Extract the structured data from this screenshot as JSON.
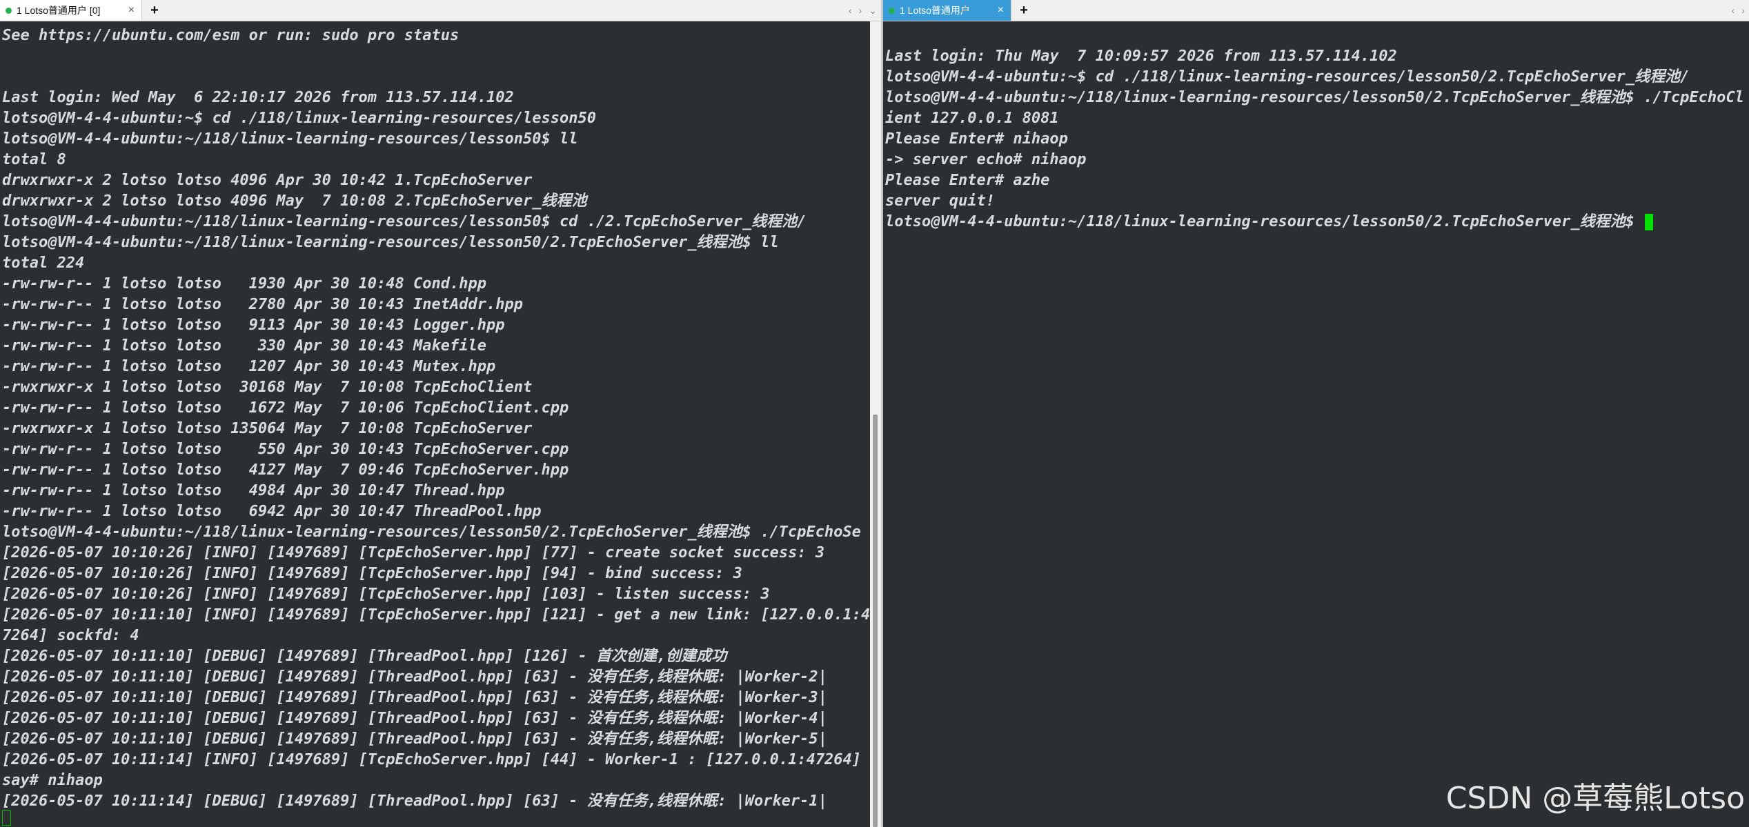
{
  "left": {
    "tab_title": "1 Lotso普通用户 [0]",
    "lines": [
      "See https://ubuntu.com/esm or run: sudo pro status",
      "",
      "",
      "Last login: Wed May  6 22:10:17 2026 from 113.57.114.102",
      "lotso@VM-4-4-ubuntu:~$ cd ./118/linux-learning-resources/lesson50",
      "lotso@VM-4-4-ubuntu:~/118/linux-learning-resources/lesson50$ ll",
      "total 8",
      "drwxrwxr-x 2 lotso lotso 4096 Apr 30 10:42 1.TcpEchoServer",
      "drwxrwxr-x 2 lotso lotso 4096 May  7 10:08 2.TcpEchoServer_线程池",
      "lotso@VM-4-4-ubuntu:~/118/linux-learning-resources/lesson50$ cd ./2.TcpEchoServer_线程池/",
      "lotso@VM-4-4-ubuntu:~/118/linux-learning-resources/lesson50/2.TcpEchoServer_线程池$ ll",
      "total 224",
      "-rw-rw-r-- 1 lotso lotso   1930 Apr 30 10:48 Cond.hpp",
      "-rw-rw-r-- 1 lotso lotso   2780 Apr 30 10:43 InetAddr.hpp",
      "-rw-rw-r-- 1 lotso lotso   9113 Apr 30 10:43 Logger.hpp",
      "-rw-rw-r-- 1 lotso lotso    330 Apr 30 10:43 Makefile",
      "-rw-rw-r-- 1 lotso lotso   1207 Apr 30 10:43 Mutex.hpp",
      "-rwxrwxr-x 1 lotso lotso  30168 May  7 10:08 TcpEchoClient",
      "-rw-rw-r-- 1 lotso lotso   1672 May  7 10:06 TcpEchoClient.cpp",
      "-rwxrwxr-x 1 lotso lotso 135064 May  7 10:08 TcpEchoServer",
      "-rw-rw-r-- 1 lotso lotso    550 Apr 30 10:43 TcpEchoServer.cpp",
      "-rw-rw-r-- 1 lotso lotso   4127 May  7 09:46 TcpEchoServer.hpp",
      "-rw-rw-r-- 1 lotso lotso   4984 Apr 30 10:47 Thread.hpp",
      "-rw-rw-r-- 1 lotso lotso   6942 Apr 30 10:47 ThreadPool.hpp",
      "lotso@VM-4-4-ubuntu:~/118/linux-learning-resources/lesson50/2.TcpEchoServer_线程池$ ./TcpEchoSe",
      "[2026-05-07 10:10:26] [INFO] [1497689] [TcpEchoServer.hpp] [77] - create socket success: 3",
      "[2026-05-07 10:10:26] [INFO] [1497689] [TcpEchoServer.hpp] [94] - bind success: 3",
      "[2026-05-07 10:10:26] [INFO] [1497689] [TcpEchoServer.hpp] [103] - listen success: 3",
      "[2026-05-07 10:11:10] [INFO] [1497689] [TcpEchoServer.hpp] [121] - get a new link: [127.0.0.1:4",
      "7264] sockfd: 4",
      "[2026-05-07 10:11:10] [DEBUG] [1497689] [ThreadPool.hpp] [126] - 首次创建,创建成功",
      "[2026-05-07 10:11:10] [DEBUG] [1497689] [ThreadPool.hpp] [63] - 没有任务,线程休眠: |Worker-2|",
      "[2026-05-07 10:11:10] [DEBUG] [1497689] [ThreadPool.hpp] [63] - 没有任务,线程休眠: |Worker-3|",
      "[2026-05-07 10:11:10] [DEBUG] [1497689] [ThreadPool.hpp] [63] - 没有任务,线程休眠: |Worker-4|",
      "[2026-05-07 10:11:10] [DEBUG] [1497689] [ThreadPool.hpp] [63] - 没有任务,线程休眠: |Worker-5|",
      "[2026-05-07 10:11:14] [INFO] [1497689] [TcpEchoServer.hpp] [44] - Worker-1 : [127.0.0.1:47264]",
      "say# nihaop",
      "[2026-05-07 10:11:14] [DEBUG] [1497689] [ThreadPool.hpp] [63] - 没有任务,线程休眠: |Worker-1|"
    ]
  },
  "right": {
    "tab_title": "1 Lotso普通用户",
    "lines": [
      "",
      "Last login: Thu May  7 10:09:57 2026 from 113.57.114.102",
      "lotso@VM-4-4-ubuntu:~$ cd ./118/linux-learning-resources/lesson50/2.TcpEchoServer_线程池/",
      "lotso@VM-4-4-ubuntu:~/118/linux-learning-resources/lesson50/2.TcpEchoServer_线程池$ ./TcpEchoCl",
      "ient 127.0.0.1 8081",
      "Please Enter# nihaop",
      "-> server echo# nihaop",
      "Please Enter# azhe",
      "server quit!"
    ],
    "prompt": "lotso@VM-4-4-ubuntu:~/118/linux-learning-resources/lesson50/2.TcpEchoServer_线程池$ "
  },
  "ui": {
    "add_tab": "+",
    "close": "×",
    "nav_prev": "‹",
    "nav_next": "›",
    "menu": "⌄"
  },
  "watermark": "CSDN @草莓熊Lotso",
  "colors": {
    "terminal_bg": "#2b2f31",
    "text": "#d7dade",
    "cursor": "#00e000",
    "active_tab": "#3a9bd9"
  }
}
